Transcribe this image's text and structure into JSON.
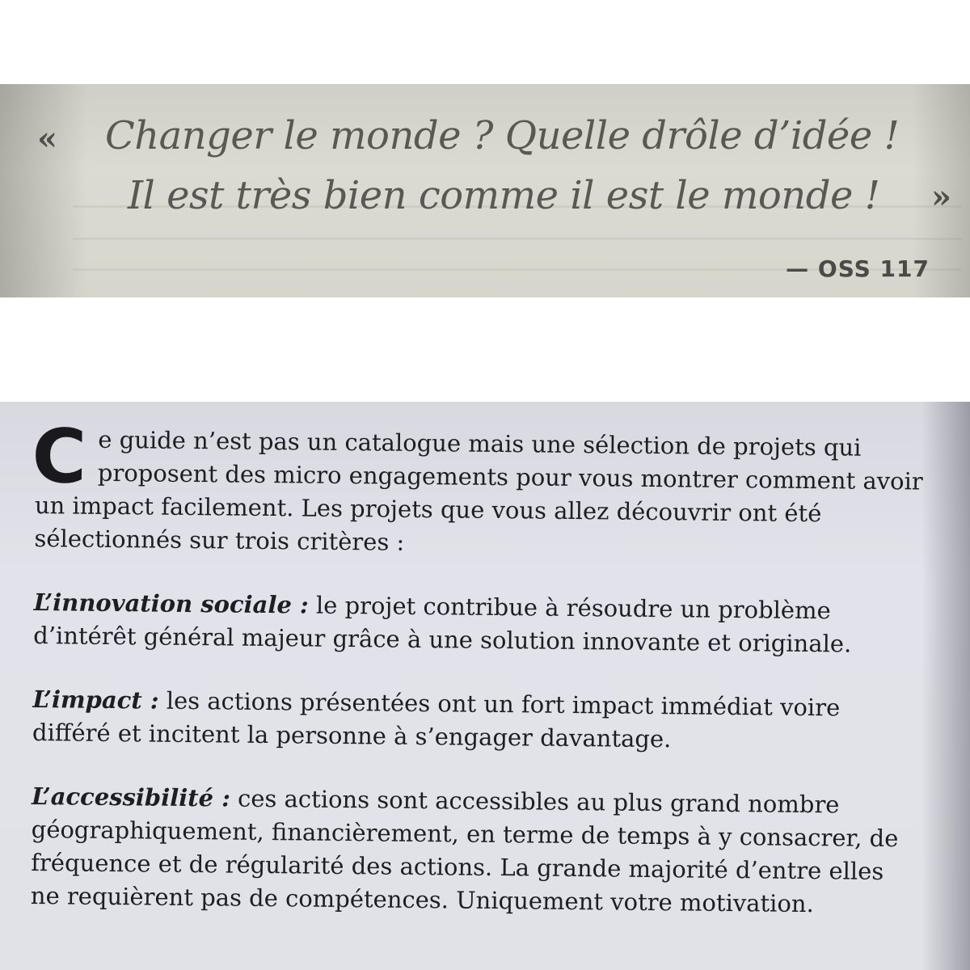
{
  "quote": {
    "open_mark": "«",
    "line1": "Changer le monde ? Quelle drôle d’idée !",
    "line2": "Il est très bien comme il est le monde !",
    "close_mark": "»",
    "attribution": "— OSS 117"
  },
  "guide": {
    "drop_cap": "C",
    "intro": "e guide n’est pas un catalogue mais une sélection de projets qui proposent des micro engagements pour vous montrer comment avoir un impact facilement. Les projets que vous allez découvrir ont été sélectionnés sur trois critères :",
    "criteria": [
      {
        "term": "L’innovation sociale :",
        "text": " le projet contribue à résoudre un problème d’intérêt général majeur grâce à une solution innovante et originale."
      },
      {
        "term": "L’impact :",
        "text": " les actions présentées ont un fort impact immédiat voire différé et incitent la personne à s’engager davantage."
      },
      {
        "term": "L’accessibilité :",
        "text": " ces actions sont accessibles au plus grand nombre géographiquement, financièrement, en terme de temps à y consacrer, de fréquence et de régularité des actions. La grande majorité d’entre elles ne requièrent pas de compétences. Uniquement votre motivation."
      }
    ]
  }
}
